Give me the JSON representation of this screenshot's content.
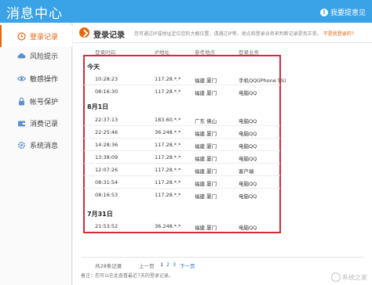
{
  "window": {
    "title": "消息中心",
    "feedback_label": "我要提意见"
  },
  "sidebar": {
    "items": [
      {
        "label": "登录记录",
        "icon": "clock-icon",
        "active": true
      },
      {
        "label": "风险提示",
        "icon": "cloud-alert-icon",
        "active": false
      },
      {
        "label": "敏感操作",
        "icon": "eye-icon",
        "active": false
      },
      {
        "label": "帐号保护",
        "icon": "lock-icon",
        "active": false
      },
      {
        "label": "消费记录",
        "icon": "wallet-icon",
        "active": false
      },
      {
        "label": "系统消息",
        "icon": "gear-icon",
        "active": false
      }
    ]
  },
  "section": {
    "title": "登录记录",
    "description": "您可通过IP或地址定位您的大概位置，请通过IP等，地点和登录业务来判断记录是否正常。",
    "help_link": "不是我登录的?",
    "columns": [
      "登录时间",
      "IP地址",
      "参考地点",
      "登录业务"
    ]
  },
  "groups": [
    {
      "label": "今天",
      "rows": [
        {
          "time": "10:28:23",
          "ip": "117.28.*.*",
          "location": "福建 厦门",
          "business": "手机QQ(iPhone 5S)"
        },
        {
          "time": "08:16:30",
          "ip": "117.28.*.*",
          "location": "福建 厦门",
          "business": "电脑QQ"
        }
      ]
    },
    {
      "label": "8月1日",
      "rows": [
        {
          "time": "22:37:13",
          "ip": "183.60.*.*",
          "location": "广东 佛山",
          "business": "电脑QQ"
        },
        {
          "time": "22:25:46",
          "ip": "36.248.*.*",
          "location": "福建 厦门",
          "business": "电脑QQ"
        },
        {
          "time": "14:28:36",
          "ip": "117.28.*.*",
          "location": "福建 厦门",
          "business": "电脑QQ"
        },
        {
          "time": "13:38:09",
          "ip": "117.28.*.*",
          "location": "福建 厦门",
          "business": "电脑QQ"
        },
        {
          "time": "12:07:26",
          "ip": "117.28.*.*",
          "location": "福建 厦门",
          "business": "客户端"
        },
        {
          "time": "08:31:54",
          "ip": "117.28.*.*",
          "location": "福建 厦门",
          "business": "电脑QQ"
        },
        {
          "time": "08:16:53",
          "ip": "117.28.*.*",
          "location": "福建 厦门",
          "business": "电脑QQ"
        }
      ]
    },
    {
      "label": "7月31日",
      "rows": [
        {
          "time": "21:53:52",
          "ip": "36.248.*.*",
          "location": "福建 厦门",
          "business": "电脑QQ"
        }
      ]
    }
  ],
  "pagination": {
    "total": "共28条记录",
    "prev": "上一页",
    "pages": [
      "1",
      "2",
      "3"
    ],
    "current": "1",
    "next": "下一页"
  },
  "note": "备注：您可以在此查看最近7天的登录记录。",
  "watermark": "系统之家",
  "colors": {
    "titlebar": "#3aa2e6",
    "accent": "#e8650c",
    "highlight_box": "#d8293a",
    "link": "#2a72c8"
  }
}
